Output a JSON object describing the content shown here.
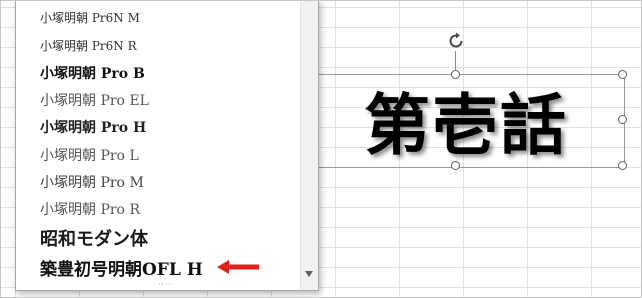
{
  "font_list": {
    "items": [
      {
        "label": "小塚明朝 Pr6N M"
      },
      {
        "label": "小塚明朝 Pr6N R"
      },
      {
        "label": "小塚明朝 Pro B"
      },
      {
        "label": "小塚明朝 Pro EL"
      },
      {
        "label": "小塚明朝 Pro H"
      },
      {
        "label": "小塚明朝 Pro L"
      },
      {
        "label": "小塚明朝 Pro M"
      },
      {
        "label": "小塚明朝 Pro R"
      },
      {
        "label": "昭和モダン体"
      },
      {
        "label": "築豊初号明朝OFL H"
      }
    ],
    "highlighted_item": "築豊初号明朝OFL H"
  },
  "textbox": {
    "text": "第壱話"
  },
  "colors": {
    "arrow": "#e0201c",
    "handle_border": "#5f5f5f",
    "grid": "#e1e1e1"
  },
  "icons": {
    "rotate": "rotate-handle-icon",
    "scroll_down": "scroll-down-arrow-icon",
    "pointer": "red-arrow-icon"
  }
}
